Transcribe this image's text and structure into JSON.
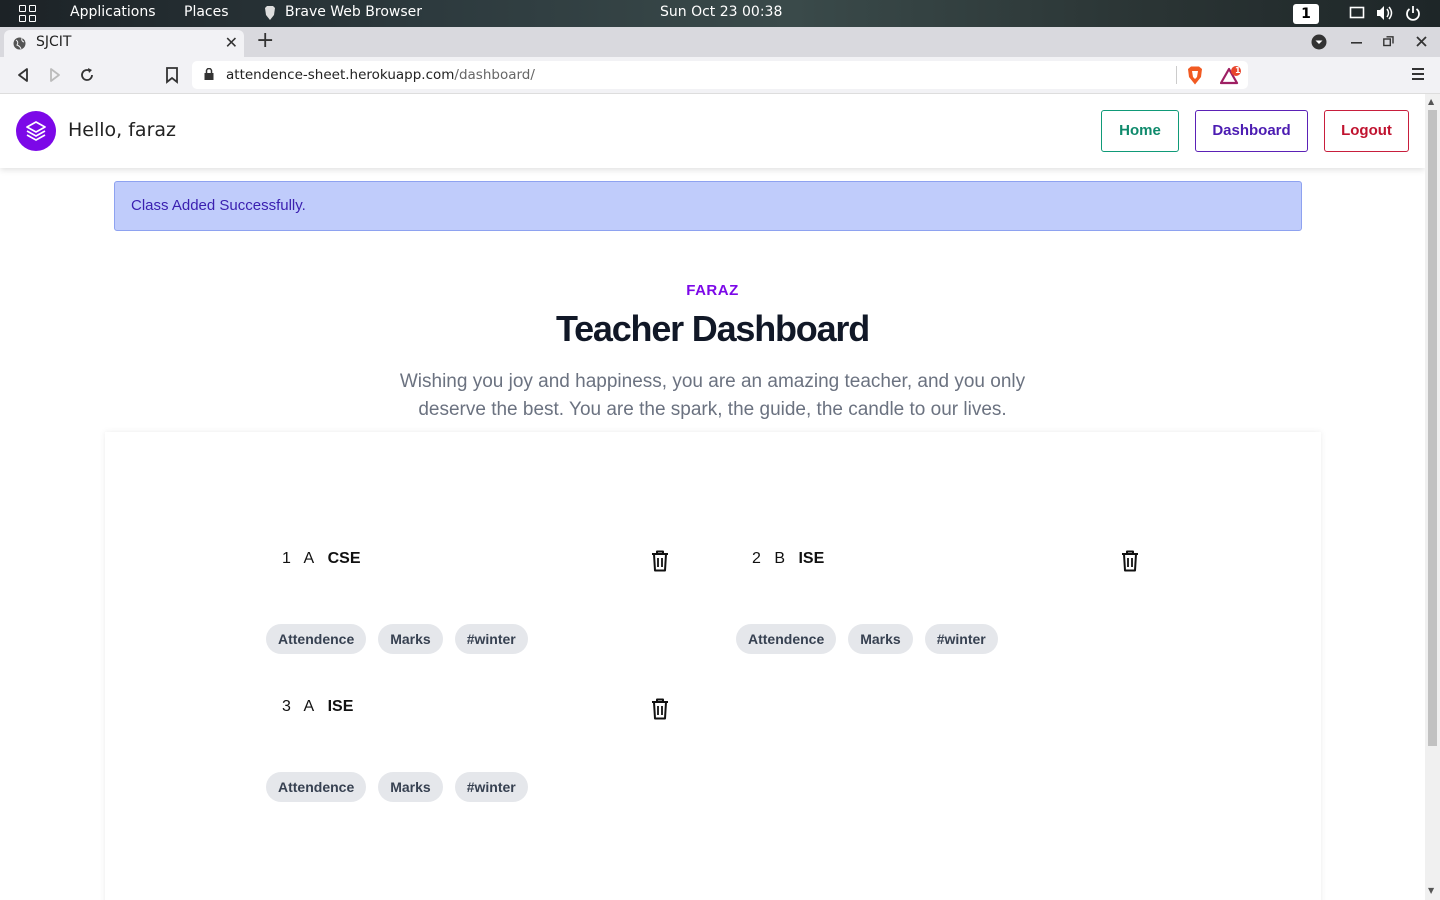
{
  "desktop": {
    "applications_label": "Applications",
    "places_label": "Places",
    "active_app": "Brave Web Browser",
    "clock": "Sun Oct 23  00:38",
    "workspace": "1"
  },
  "browser": {
    "tab_title": "SJCIT",
    "url_host": "attendence-sheet.herokuapp.com",
    "url_path": "/dashboard/",
    "rewards_badge": "1"
  },
  "header": {
    "greeting": "Hello, faraz",
    "nav": {
      "home": "Home",
      "dashboard": "Dashboard",
      "logout": "Logout"
    }
  },
  "alert": {
    "message": "Class Added Successfully."
  },
  "hero": {
    "eyebrow": "FARAZ",
    "title": "Teacher Dashboard",
    "subtitle": "Wishing you joy and happiness, you are an amazing teacher, and you only deserve the best. You are the spark, the guide, the candle to our lives."
  },
  "classes": [
    {
      "number": "1",
      "section": "A",
      "department": "CSE",
      "tags": [
        "Attendence",
        "Marks",
        "#winter"
      ]
    },
    {
      "number": "2",
      "section": "B",
      "department": "ISE",
      "tags": [
        "Attendence",
        "Marks",
        "#winter"
      ]
    },
    {
      "number": "3",
      "section": "A",
      "department": "ISE",
      "tags": [
        "Attendence",
        "Marks",
        "#winter"
      ]
    }
  ],
  "colors": {
    "brand": "#7c08e8",
    "home_button": "#0f8a6c",
    "dashboard_button": "#4c1cb2",
    "logout_button": "#c0132f",
    "alert_bg": "#c0ccfb"
  }
}
